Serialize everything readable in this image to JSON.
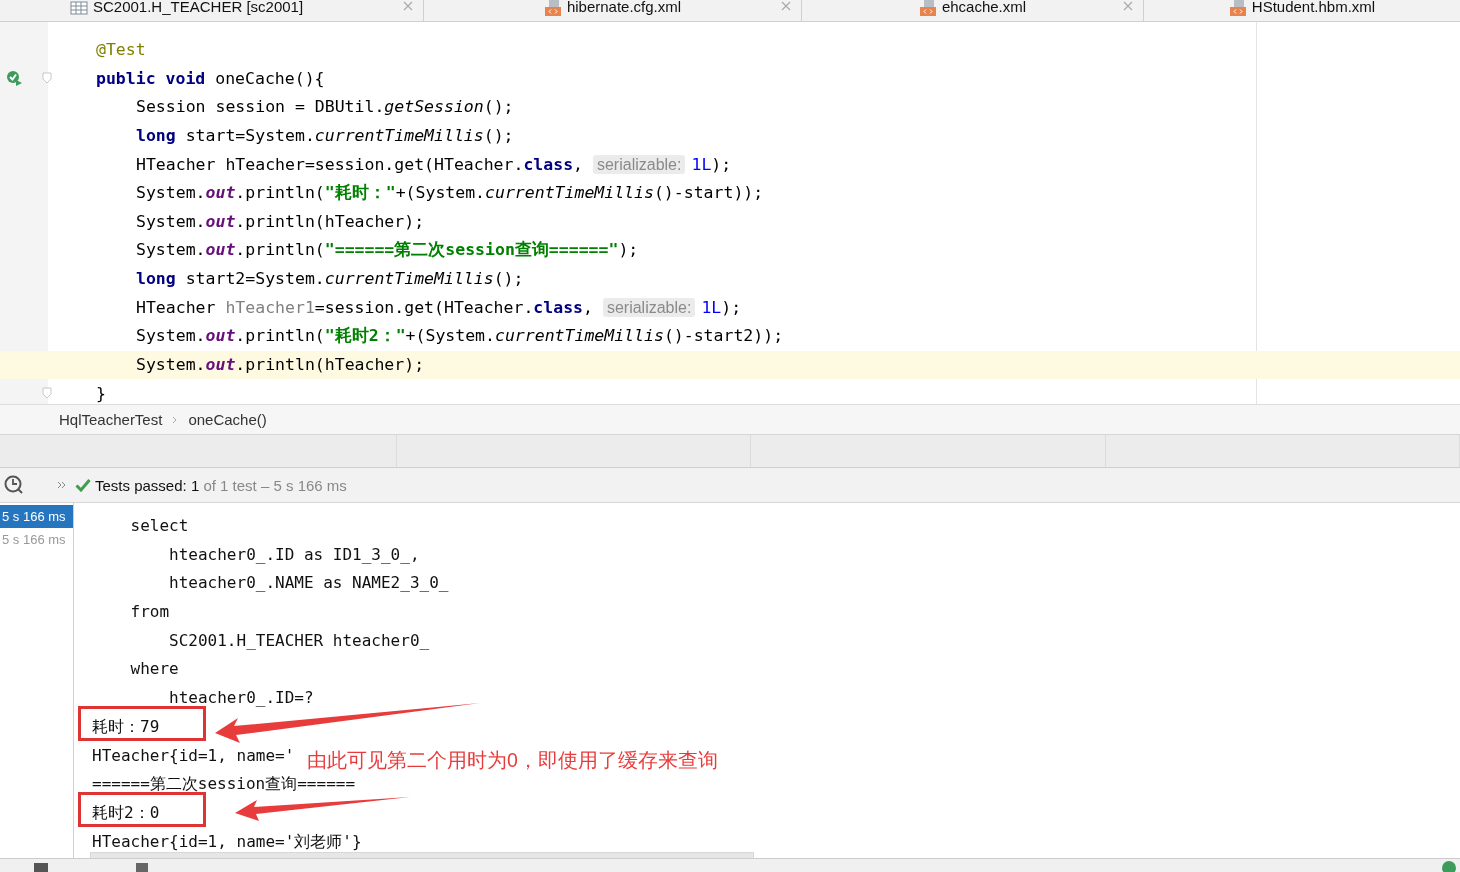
{
  "tabs": [
    {
      "label": "SC2001.H_TEACHER [sc2001]",
      "kind": "table"
    },
    {
      "label": "hibernate.cfg.xml",
      "kind": "xml"
    },
    {
      "label": "ehcache.xml",
      "kind": "xml"
    },
    {
      "label": "HStudent.hbm.xml",
      "kind": "xml"
    }
  ],
  "editor": {
    "lines": [
      {
        "current": false,
        "fold": false,
        "run": false,
        "tokens": [
          {
            "kind": "annotation",
            "text": "@Test"
          }
        ]
      },
      {
        "current": false,
        "fold": true,
        "run": true,
        "tokens": [
          {
            "kind": "keyword",
            "text": "public "
          },
          {
            "kind": "keyword",
            "text": "void"
          },
          {
            "kind": "plain",
            "text": " oneCache(){"
          }
        ],
        "children": [
          {
            "current": false,
            "fold": false,
            "run": false,
            "tokens": [
              {
                "kind": "plain",
                "text": "Session session = DBUtil."
              },
              {
                "kind": "italic",
                "text": "getSession"
              },
              {
                "kind": "plain",
                "text": "();"
              }
            ]
          },
          {
            "current": false,
            "fold": false,
            "run": false,
            "tokens": [
              {
                "kind": "keyword",
                "text": "long"
              },
              {
                "kind": "plain",
                "text": " start=System."
              },
              {
                "kind": "italic",
                "text": "currentTimeMillis"
              },
              {
                "kind": "plain",
                "text": "();"
              }
            ]
          },
          {
            "current": false,
            "fold": false,
            "run": false,
            "tokens": [
              {
                "kind": "plain",
                "text": "HTeacher hTeacher=session.get(HTeacher."
              },
              {
                "kind": "keyword",
                "text": "class"
              },
              {
                "kind": "plain",
                "text": ", "
              },
              {
                "kind": "hint",
                "text": "serializable:"
              },
              {
                "kind": "number",
                "text": "1L"
              },
              {
                "kind": "plain",
                "text": ");"
              }
            ]
          },
          {
            "current": false,
            "fold": false,
            "run": false,
            "tokens": [
              {
                "kind": "plain",
                "text": "System."
              },
              {
                "kind": "field",
                "text": "out"
              },
              {
                "kind": "plain",
                "text": ".println("
              },
              {
                "kind": "string",
                "text": "\"耗时：\""
              },
              {
                "kind": "plain",
                "text": "+(System."
              },
              {
                "kind": "italic",
                "text": "currentTimeMillis"
              },
              {
                "kind": "plain",
                "text": "()-start));"
              }
            ]
          },
          {
            "current": false,
            "fold": false,
            "run": false,
            "tokens": [
              {
                "kind": "plain",
                "text": "System."
              },
              {
                "kind": "field",
                "text": "out"
              },
              {
                "kind": "plain",
                "text": ".println(hTeacher);"
              }
            ]
          },
          {
            "current": false,
            "fold": false,
            "run": false,
            "tokens": [
              {
                "kind": "plain",
                "text": "System."
              },
              {
                "kind": "field",
                "text": "out"
              },
              {
                "kind": "plain",
                "text": ".println("
              },
              {
                "kind": "string",
                "text": "\"======第二次session查询======\""
              },
              {
                "kind": "plain",
                "text": ");"
              }
            ]
          },
          {
            "current": false,
            "fold": false,
            "run": false,
            "tokens": [
              {
                "kind": "keyword",
                "text": "long"
              },
              {
                "kind": "plain",
                "text": " start2=System."
              },
              {
                "kind": "italic",
                "text": "currentTimeMillis"
              },
              {
                "kind": "plain",
                "text": "();"
              }
            ]
          },
          {
            "current": false,
            "fold": false,
            "run": false,
            "tokens": [
              {
                "kind": "plain",
                "text": "HTeacher "
              },
              {
                "kind": "unused",
                "text": "hTeacher1"
              },
              {
                "kind": "plain",
                "text": "=session.get(HTeacher."
              },
              {
                "kind": "keyword",
                "text": "class"
              },
              {
                "kind": "plain",
                "text": ", "
              },
              {
                "kind": "hint",
                "text": "serializable:"
              },
              {
                "kind": "number",
                "text": "1L"
              },
              {
                "kind": "plain",
                "text": ");"
              }
            ]
          },
          {
            "current": false,
            "fold": false,
            "run": false,
            "tokens": [
              {
                "kind": "plain",
                "text": "System."
              },
              {
                "kind": "field",
                "text": "out"
              },
              {
                "kind": "plain",
                "text": ".println("
              },
              {
                "kind": "string",
                "text": "\"耗时2：\""
              },
              {
                "kind": "plain",
                "text": "+(System."
              },
              {
                "kind": "italic",
                "text": "currentTimeMillis"
              },
              {
                "kind": "plain",
                "text": "()-start2));"
              }
            ]
          },
          {
            "current": true,
            "fold": false,
            "run": false,
            "tokens": [
              {
                "kind": "plain",
                "text": "System."
              },
              {
                "kind": "field",
                "text": "out"
              },
              {
                "kind": "plain",
                "text": ".println(hTeacher);"
              }
            ]
          }
        ]
      },
      {
        "current": false,
        "fold": true,
        "run": false,
        "tokens": [
          {
            "kind": "plain",
            "text": "}"
          }
        ]
      }
    ]
  },
  "breadcrumb": [
    "HqlTeacherTest",
    "oneCache()"
  ],
  "test_status": {
    "passed": "Tests passed: 1",
    "rest": "of 1 test – 5 s 166 ms"
  },
  "test_tree": [
    {
      "label": "5 s 166 ms",
      "selected": true
    },
    {
      "label": "5 s 166 ms",
      "selected": false
    }
  ],
  "console": {
    "lines": [
      {
        "text": "    select",
        "highlighted": false
      },
      {
        "text": "        hteacher0_.ID as ID1_3_0_,",
        "highlighted": false
      },
      {
        "text": "        hteacher0_.NAME as NAME2_3_0_",
        "highlighted": false
      },
      {
        "text": "    from",
        "highlighted": false
      },
      {
        "text": "        SC2001.H_TEACHER hteacher0_",
        "highlighted": false
      },
      {
        "text": "    where",
        "highlighted": false
      },
      {
        "text": "        hteacher0_.ID=?",
        "highlighted": false
      },
      {
        "text": "耗时：79",
        "highlighted": true
      },
      {
        "text": "HTeacher{id=1, name='",
        "highlighted": false
      },
      {
        "text": "======第二次session查询======",
        "highlighted": false
      },
      {
        "text": "耗时2：0",
        "highlighted": true
      },
      {
        "text": "HTeacher{id=1, name='刘老师'}",
        "highlighted": false
      }
    ],
    "note": "由此可见第二个用时为0，即使用了缓存来查询"
  }
}
